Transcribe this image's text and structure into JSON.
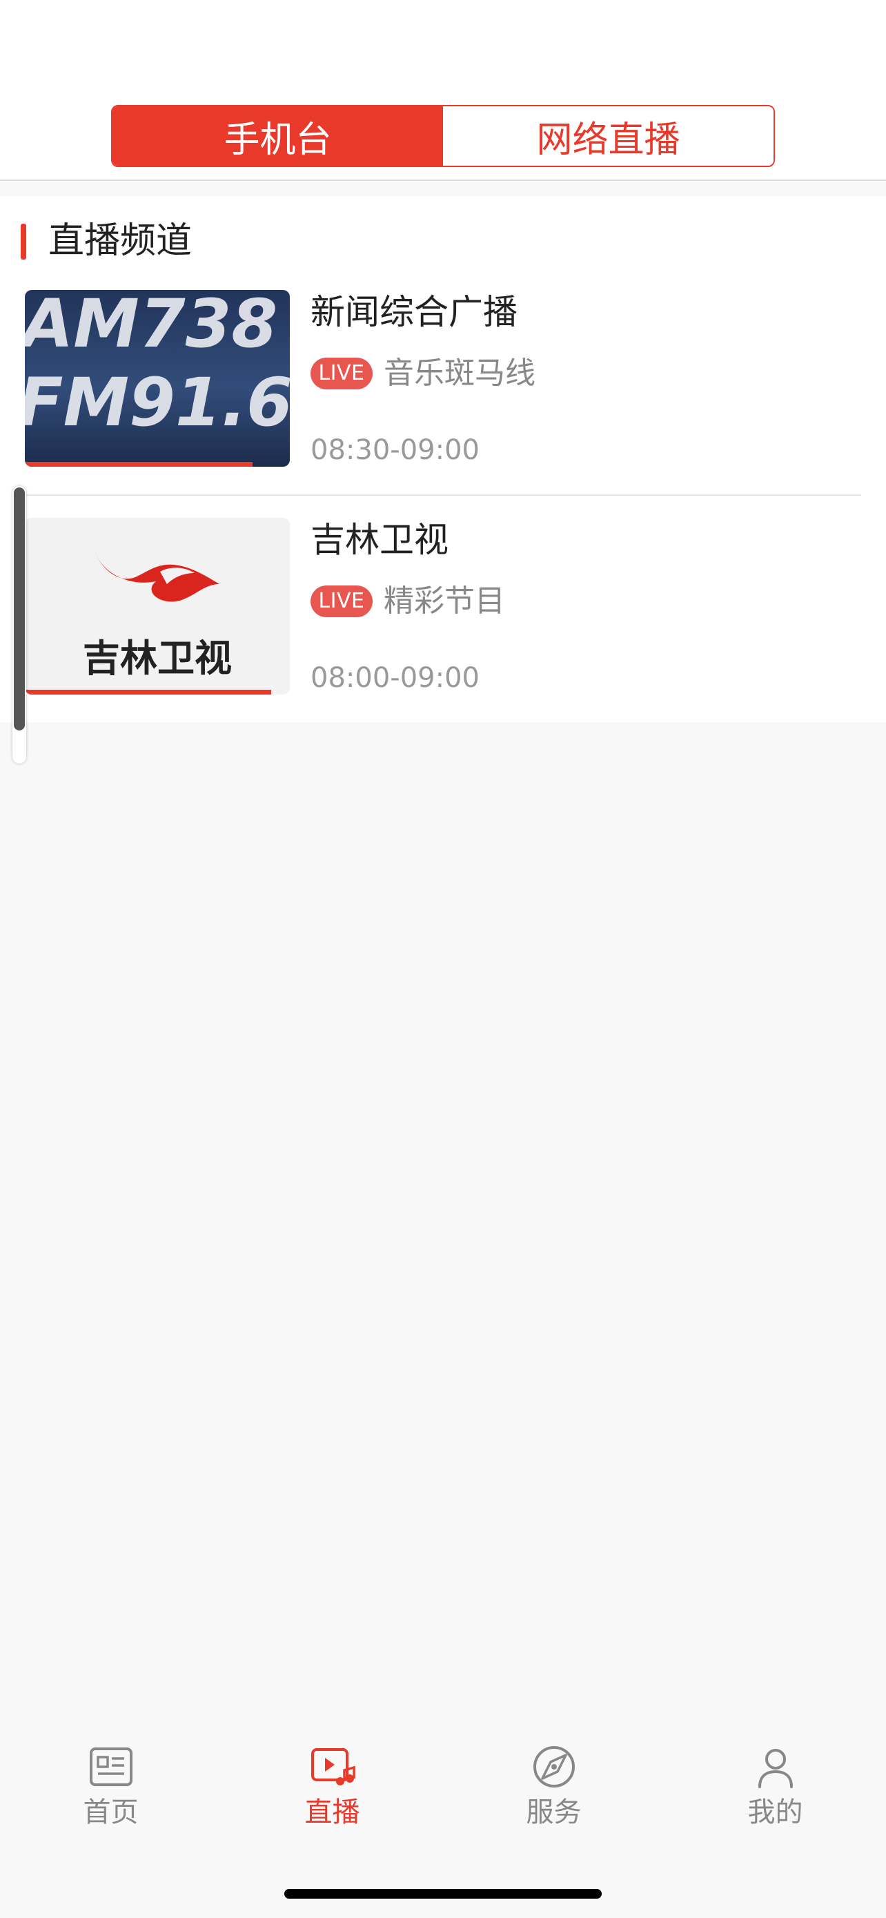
{
  "header": {
    "tabs": [
      {
        "label": "手机台",
        "active": true
      },
      {
        "label": "网络直播",
        "active": false
      }
    ]
  },
  "section": {
    "title": "直播频道"
  },
  "channels": [
    {
      "title": "新闻综合广播",
      "live_badge": "LIVE",
      "program": "音乐斑马线",
      "time": "08:30-09:00",
      "thumb_lines": [
        "AM738",
        "FM91.6"
      ],
      "progress": 0.86
    },
    {
      "title": "吉林卫视",
      "live_badge": "LIVE",
      "program": "精彩节目",
      "time": "08:00-09:00",
      "logo_text": "吉林卫视",
      "progress": 0.93
    }
  ],
  "tabbar": {
    "items": [
      {
        "label": "首页",
        "icon": "news-icon",
        "active": false
      },
      {
        "label": "直播",
        "icon": "live-video-icon",
        "active": true
      },
      {
        "label": "服务",
        "icon": "service-compass-icon",
        "active": false
      },
      {
        "label": "我的",
        "icon": "profile-icon",
        "active": false
      }
    ]
  },
  "colors": {
    "accent": "#e8392b",
    "live_badge": "#e85650",
    "muted_text": "#888888",
    "background": "#f8f8f8"
  }
}
